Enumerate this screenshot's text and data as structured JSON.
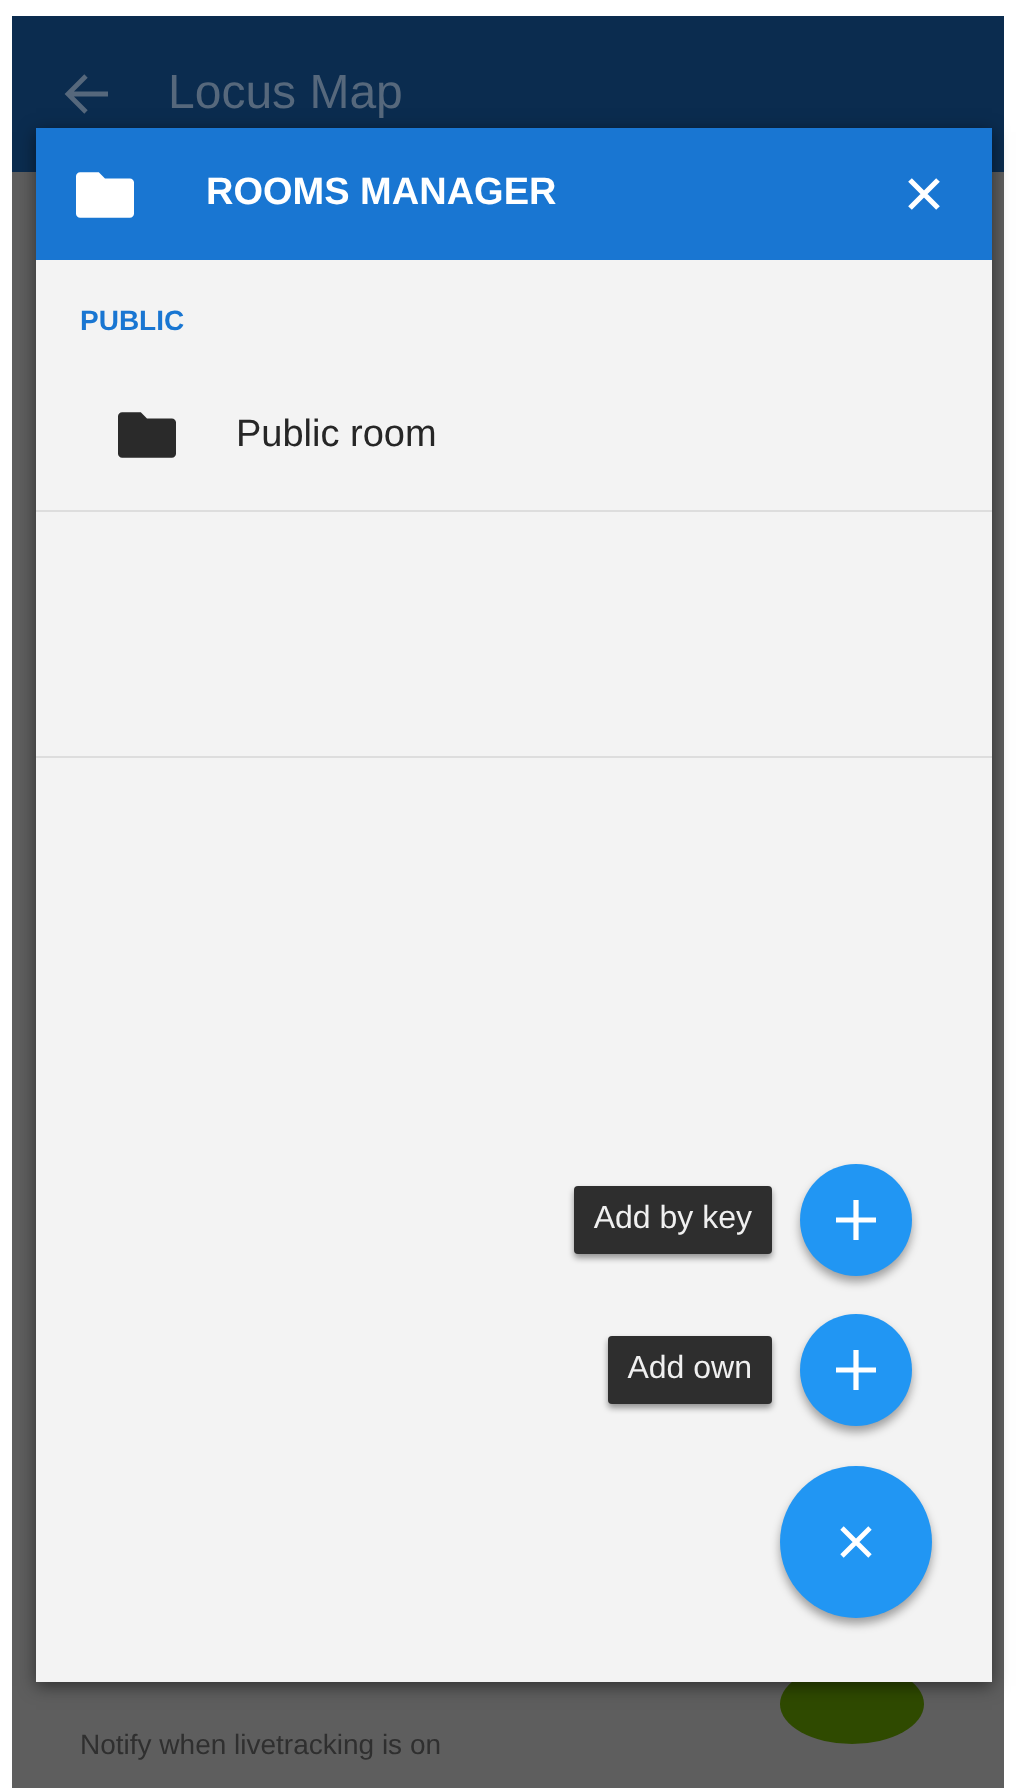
{
  "background": {
    "title": "Locus Map",
    "setting_description": "Notify when livetracking is on",
    "switch_on": true
  },
  "dialog": {
    "title": "ROOMS MANAGER",
    "sections": [
      {
        "label": "PUBLIC",
        "rooms": [
          {
            "name": "Public room"
          }
        ]
      }
    ]
  },
  "actions": [
    {
      "label": "Add by key"
    },
    {
      "label": "Add own"
    }
  ]
}
